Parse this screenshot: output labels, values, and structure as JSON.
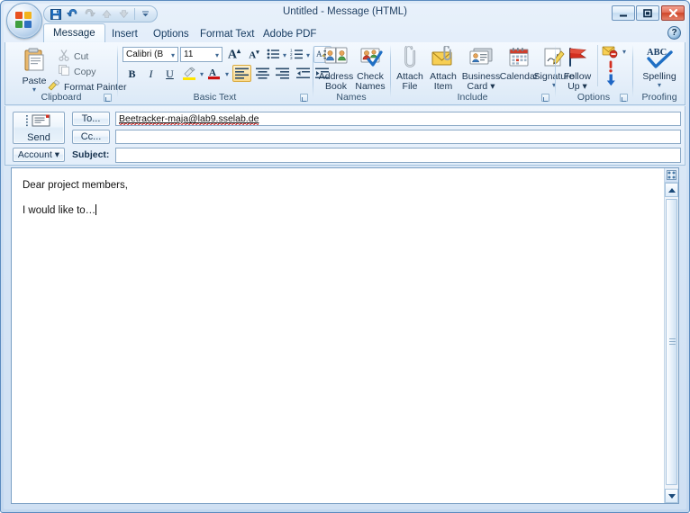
{
  "window": {
    "title": "Untitled  -  Message (HTML)",
    "minimize_label": "–",
    "maximize_label": "❐",
    "close_label": "✕",
    "help_label": "?"
  },
  "quick_access": {
    "items": [
      {
        "name": "save-icon",
        "label": "Save"
      },
      {
        "name": "undo-icon",
        "label": "Undo"
      },
      {
        "name": "redo-icon",
        "label": "Redo"
      },
      {
        "name": "previous-item-icon",
        "label": "Previous Item"
      },
      {
        "name": "next-item-icon",
        "label": "Next Item"
      },
      {
        "name": "customize-quick-access-icon",
        "label": "Customize Quick Access Toolbar"
      }
    ]
  },
  "tabs": [
    {
      "label": "Message",
      "active": true
    },
    {
      "label": "Insert",
      "active": false
    },
    {
      "label": "Options",
      "active": false
    },
    {
      "label": "Format Text",
      "active": false
    },
    {
      "label": "Adobe PDF",
      "active": false
    }
  ],
  "ribbon": {
    "groups": [
      {
        "name": "clipboard",
        "label": "Clipboard",
        "items": [
          {
            "label": "Paste",
            "icon": "paste-icon"
          },
          {
            "label": "Cut",
            "icon": "cut-icon",
            "disabled": true
          },
          {
            "label": "Copy",
            "icon": "copy-icon",
            "disabled": true
          },
          {
            "label": "Format Painter",
            "icon": "format-painter-icon",
            "disabled": false
          }
        ]
      },
      {
        "name": "basic-text",
        "label": "Basic Text",
        "font_name": "Calibri (B",
        "font_size": "11",
        "items": [
          {
            "label": "Grow Font",
            "icon": "grow-font-icon"
          },
          {
            "label": "Shrink Font",
            "icon": "shrink-font-icon"
          },
          {
            "label": "Bullets",
            "icon": "bullets-icon"
          },
          {
            "label": "Numbering",
            "icon": "numbering-icon"
          },
          {
            "label": "Clear Formatting",
            "icon": "clear-formatting-icon"
          },
          {
            "label": "Bold",
            "icon": "bold-icon"
          },
          {
            "label": "Italic",
            "icon": "italic-icon"
          },
          {
            "label": "Underline",
            "icon": "underline-icon"
          },
          {
            "label": "Text Highlight Color",
            "icon": "highlight-icon"
          },
          {
            "label": "Font Color",
            "icon": "font-color-icon"
          },
          {
            "label": "Align Left",
            "icon": "align-left-icon"
          },
          {
            "label": "Center",
            "icon": "align-center-icon"
          },
          {
            "label": "Align Right",
            "icon": "align-right-icon"
          },
          {
            "label": "Decrease Indent",
            "icon": "decrease-indent-icon"
          },
          {
            "label": "Increase Indent",
            "icon": "increase-indent-icon"
          }
        ]
      },
      {
        "name": "names",
        "label": "Names",
        "items": [
          {
            "label1": "Address",
            "label2": "Book",
            "icon": "address-book-icon"
          },
          {
            "label1": "Check",
            "label2": "Names",
            "icon": "check-names-icon"
          }
        ]
      },
      {
        "name": "include",
        "label": "Include",
        "items": [
          {
            "label1": "Attach",
            "label2": "File",
            "icon": "attach-file-icon"
          },
          {
            "label1": "Attach",
            "label2": "Item",
            "icon": "attach-item-icon"
          },
          {
            "label1": "Business",
            "label2": "Card ▾",
            "icon": "business-card-icon"
          },
          {
            "label1": "Calendar",
            "label2": "",
            "icon": "calendar-icon"
          },
          {
            "label1": "Signature",
            "label2": "▾",
            "icon": "signature-icon"
          }
        ]
      },
      {
        "name": "options",
        "label": "Options",
        "items": [
          {
            "label1": "Follow",
            "label2": "Up ▾",
            "icon": "follow-up-flag-icon"
          },
          {
            "label": "Permission",
            "icon": "permission-icon"
          },
          {
            "label": "High Importance",
            "icon": "high-importance-icon"
          },
          {
            "label": "Low Importance",
            "icon": "low-importance-icon"
          }
        ]
      },
      {
        "name": "proofing",
        "label": "Proofing",
        "items": [
          {
            "label1": "Spelling",
            "label2": "▾",
            "icon": "spelling-icon"
          }
        ]
      }
    ]
  },
  "compose": {
    "send_label": "Send",
    "account_label": "Account ▾",
    "to_label": "To...",
    "cc_label": "Cc...",
    "subject_label": "Subject:",
    "to_value": "Beetracker-maja@lab9.sselab.de",
    "cc_value": "",
    "subject_value": ""
  },
  "body": {
    "paragraph1": "Dear project members,",
    "paragraph2": "I would like to…"
  },
  "colors": {
    "accent": "#1b4a7a",
    "close_button": "#cf4426",
    "flag_red": "#cf2b21",
    "highlight_yellow": "#ffe500",
    "font_color_red": "#cc1111",
    "spell_error": "#d01818"
  }
}
